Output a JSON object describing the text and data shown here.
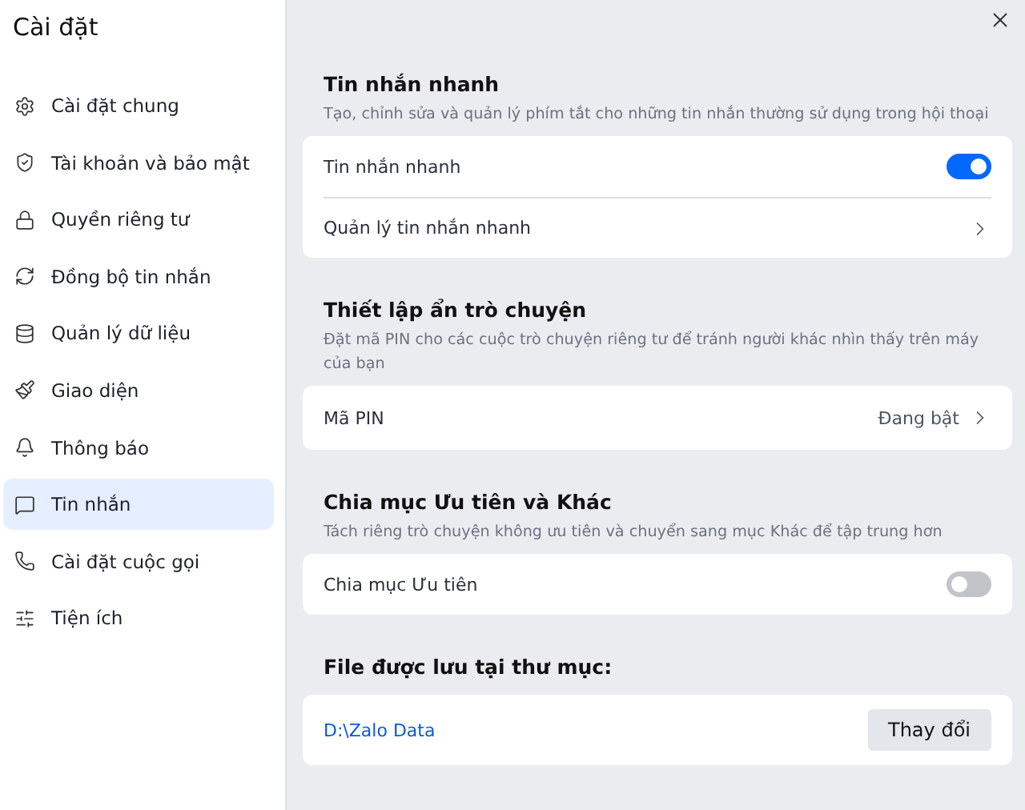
{
  "sidebar": {
    "title": "Cài đặt",
    "items": [
      {
        "label": "Cài đặt chung",
        "selected": false
      },
      {
        "label": "Tài khoản và bảo mật",
        "selected": false
      },
      {
        "label": "Quyền riêng tư",
        "selected": false
      },
      {
        "label": "Đồng bộ tin nhắn",
        "selected": false
      },
      {
        "label": "Quản lý dữ liệu",
        "selected": false
      },
      {
        "label": "Giao diện",
        "selected": false
      },
      {
        "label": "Thông báo",
        "selected": false
      },
      {
        "label": "Tin nhắn",
        "selected": true
      },
      {
        "label": "Cài đặt cuộc gọi",
        "selected": false
      },
      {
        "label": "Tiện ích",
        "selected": false
      }
    ]
  },
  "sections": [
    {
      "title": "Tin nhắn nhanh",
      "description": "Tạo, chỉnh sửa và quản lý phím tắt cho những tin nhắn thường sử dụng trong hội thoại",
      "rows": [
        {
          "kind": "toggle",
          "label": "Tin nhắn nhanh",
          "on": true
        },
        {
          "kind": "link",
          "label": "Quản lý tin nhắn nhanh"
        }
      ]
    },
    {
      "title": "Thiết lập ẩn trò chuyện",
      "description": "Đặt mã PIN cho các cuộc trò chuyện riêng tư để tránh người khác nhìn thấy trên máy của bạn",
      "rows": [
        {
          "kind": "link",
          "label": "Mã PIN",
          "value": "Đang bật"
        }
      ]
    },
    {
      "title": "Chia mục Ưu tiên và Khác",
      "description": "Tách riêng trò chuyện không ưu tiên và chuyển sang mục Khác để tập trung hơn",
      "rows": [
        {
          "kind": "toggle",
          "label": "Chia mục Ưu tiên",
          "on": false
        }
      ]
    },
    {
      "title": "File được lưu tại thư mục:",
      "rows": [
        {
          "kind": "folder",
          "path": "D:\\Zalo Data",
          "button": "Thay đổi"
        }
      ]
    }
  ]
}
